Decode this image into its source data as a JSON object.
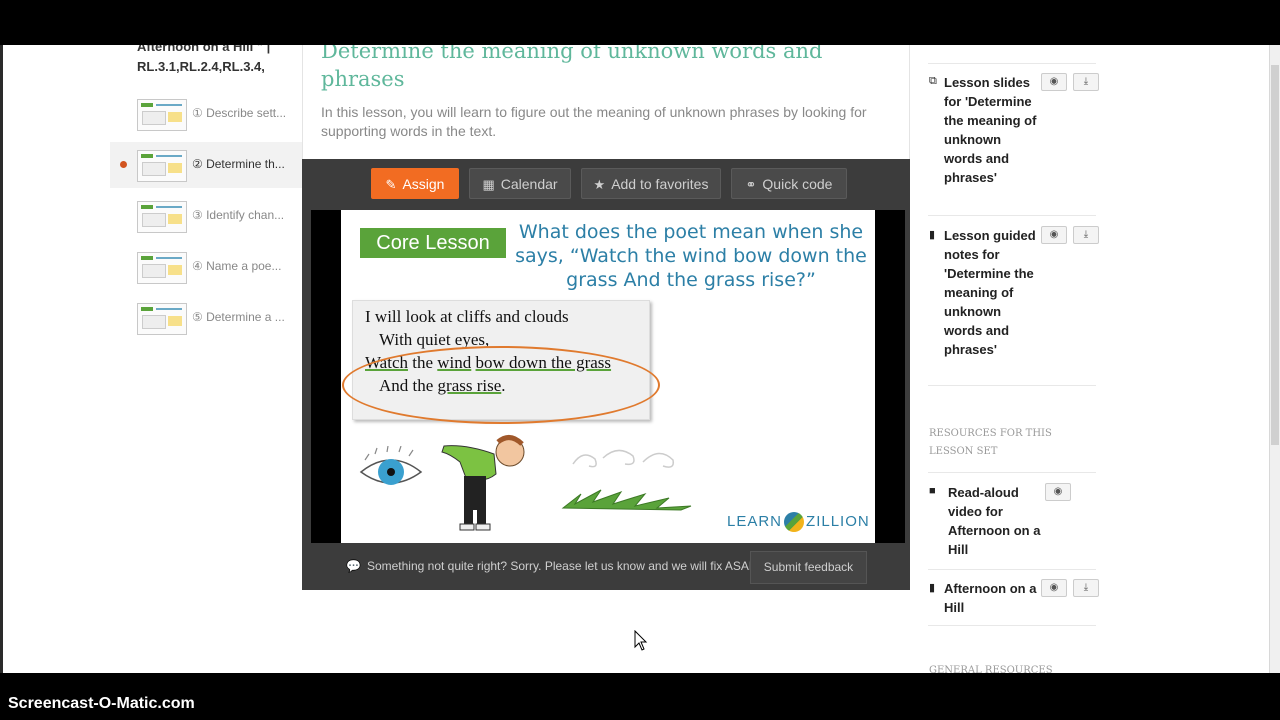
{
  "sidebar": {
    "header_line1": "Afternoon on a Hill \" |",
    "header_line2": "RL.3.1,RL.2.4,RL.3.4,",
    "items": [
      {
        "label": "① Describe sett..."
      },
      {
        "label": "② Determine th..."
      },
      {
        "label": "③ Identify chan..."
      },
      {
        "label": "④ Name a poe..."
      },
      {
        "label": "⑤ Determine a ..."
      }
    ]
  },
  "lesson": {
    "title": "Determine the meaning of unknown words and phrases",
    "description": "In this lesson, you will learn to figure out the meaning of unknown phrases by looking for supporting words in the text."
  },
  "toolbar": {
    "assign": "Assign",
    "calendar": "Calendar",
    "favorites": "Add to favorites",
    "quick_code": "Quick code"
  },
  "slide": {
    "badge": "Core Lesson",
    "question": "What does the poet mean when she says, “Watch the wind bow down the grass And the grass rise?”",
    "poem": {
      "l1": "I will look at cliffs and clouds",
      "l2": "With quiet eyes,",
      "l3a": "Watch",
      "l3b": "the",
      "l3c": "wind",
      "l3d": "bow down the grass",
      "l4a": "And the",
      "l4b": "grass rise",
      "l4c": "."
    },
    "brand_left": "LEARN",
    "brand_right": "ZILLION"
  },
  "feedback": {
    "text": "Something not quite right? Sorry. Please let us know and we will fix ASAP!",
    "button": "Submit feedback"
  },
  "resources": {
    "items": [
      {
        "label": "Lesson slides for 'Determine the meaning of unknown words and phrases'",
        "icon": "copy-icon"
      },
      {
        "label": "Lesson guided notes for 'Determine the meaning of unknown words and phrases'",
        "icon": "document-icon"
      }
    ],
    "set_heading": "RESOURCES FOR THIS LESSON SET",
    "set_items": [
      {
        "label": "Read-aloud video for Afternoon on a Hill",
        "icon": "video-icon"
      },
      {
        "label": "Afternoon on a Hill",
        "icon": "document-icon"
      }
    ],
    "general_heading": "GENERAL RESOURCES"
  },
  "colors": {
    "accent_orange": "#f26c22",
    "title_green": "#5fb79b",
    "badge_green": "#5aa33a",
    "question_blue": "#2c7fa6"
  },
  "watermark": "Screencast-O-Matic.com"
}
